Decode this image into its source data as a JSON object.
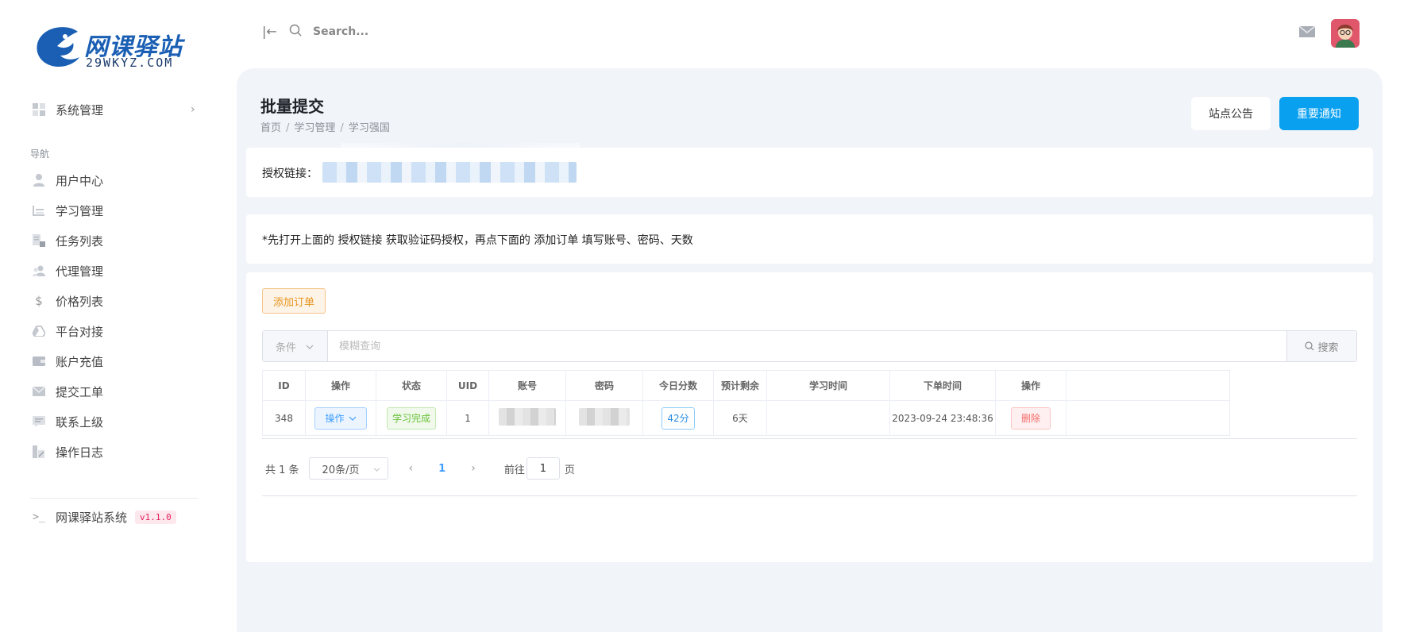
{
  "brand": {
    "name": "网课驿站",
    "domain": "29WKYZ.COM",
    "primary_color": "#1a5fb4"
  },
  "sidebar": {
    "system_item": "系统管理",
    "section_label": "导航",
    "items": [
      {
        "label": "用户中心",
        "icon": "user-icon"
      },
      {
        "label": "学习管理",
        "icon": "study-icon"
      },
      {
        "label": "任务列表",
        "icon": "task-list-icon"
      },
      {
        "label": "代理管理",
        "icon": "agent-icon"
      },
      {
        "label": "价格列表",
        "icon": "dollar-icon"
      },
      {
        "label": "平台对接",
        "icon": "platform-icon"
      },
      {
        "label": "账户充值",
        "icon": "wallet-icon"
      },
      {
        "label": "提交工单",
        "icon": "mail-icon"
      },
      {
        "label": "联系上级",
        "icon": "chat-icon"
      },
      {
        "label": "操作日志",
        "icon": "log-icon"
      }
    ],
    "footer": {
      "label": "网课驿站系统",
      "version": "v1.1.0"
    }
  },
  "topbar": {
    "search_placeholder": "Search..."
  },
  "page": {
    "title": "批量提交",
    "breadcrumb": [
      "首页",
      "学习管理",
      "学习强国"
    ],
    "btn_notice": "站点公告",
    "btn_important": "重要通知",
    "auth_label": "授权链接：",
    "tip": "*先打开上面的 授权链接 获取验证码授权，再点下面的 添加订单 填写账号、密码、天数"
  },
  "orders": {
    "add_button": "添加订单",
    "condition_placeholder": "条件",
    "query_placeholder": "模糊查询",
    "search_button": "搜索",
    "columns": [
      "ID",
      "操作",
      "状态",
      "UID",
      "账号",
      "密码",
      "今日分数",
      "预计剩余",
      "学习时间",
      "下单时间",
      "操作"
    ],
    "rows": [
      {
        "id": "348",
        "action": "操作",
        "status": "学习完成",
        "uid": "1",
        "score": "42分",
        "remaining": "6天",
        "study_time": "",
        "order_time": "2023-09-24 23:48:36",
        "delete": "删除"
      }
    ]
  },
  "pagination": {
    "total": "共 1 条",
    "page_size": "20条/页",
    "current_page": "1",
    "goto_label": "前往",
    "goto_value": "1",
    "page_suffix": "页"
  }
}
